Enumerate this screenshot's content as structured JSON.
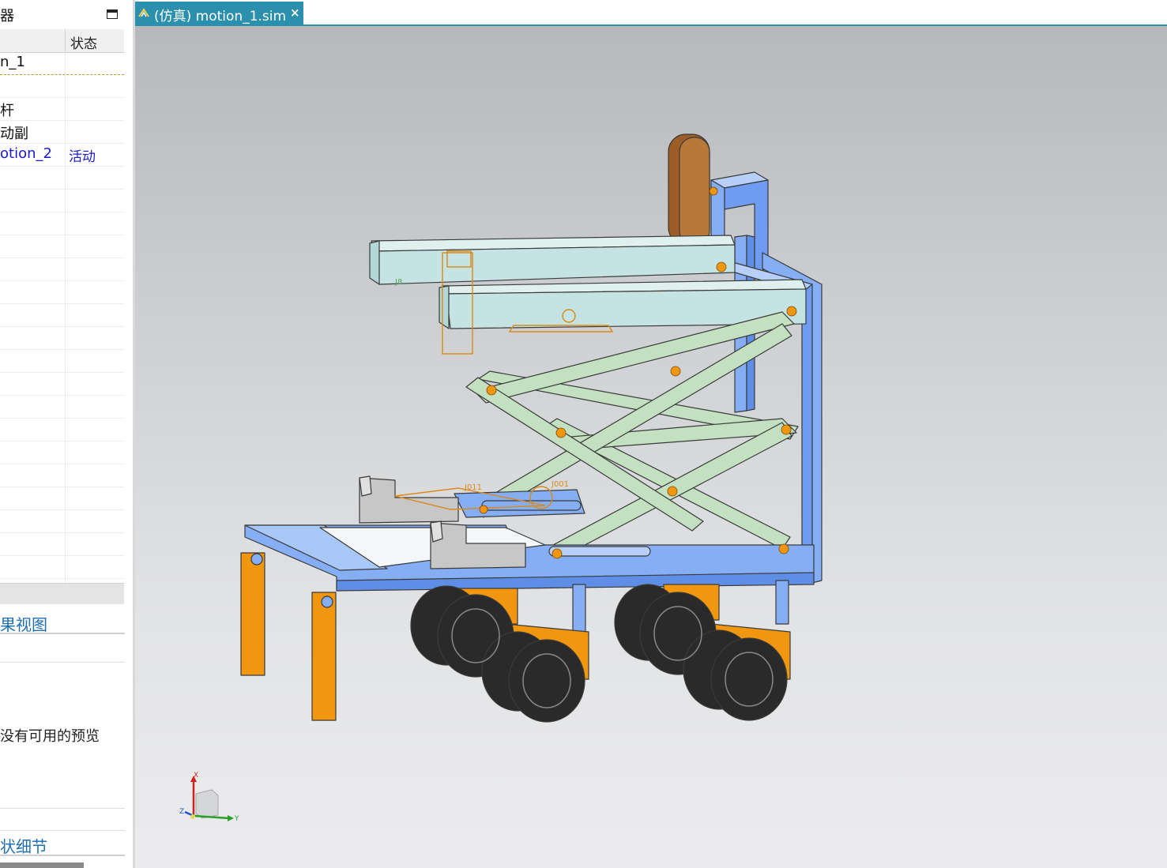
{
  "navigator": {
    "title": "器",
    "column_status": "状态",
    "rows": [
      {
        "name": "n_1",
        "status": ""
      },
      {
        "name": "",
        "status": ""
      },
      {
        "name": "杆",
        "status": ""
      },
      {
        "name": "动副",
        "status": ""
      },
      {
        "name": "otion_2",
        "status": "活动"
      },
      {
        "name": "",
        "status": ""
      },
      {
        "name": "",
        "status": ""
      },
      {
        "name": "",
        "status": ""
      },
      {
        "name": "",
        "status": ""
      },
      {
        "name": "",
        "status": ""
      },
      {
        "name": "",
        "status": ""
      },
      {
        "name": "",
        "status": ""
      },
      {
        "name": "",
        "status": ""
      },
      {
        "name": "",
        "status": ""
      },
      {
        "name": "",
        "status": ""
      },
      {
        "name": "",
        "status": ""
      },
      {
        "name": "",
        "status": ""
      },
      {
        "name": "",
        "status": ""
      },
      {
        "name": "",
        "status": ""
      },
      {
        "name": "",
        "status": ""
      },
      {
        "name": "",
        "status": ""
      },
      {
        "name": "",
        "status": ""
      },
      {
        "name": "",
        "status": ""
      },
      {
        "name": "",
        "status": ""
      }
    ]
  },
  "preview_section": {
    "title": "果视图",
    "empty_text": "没有可用的预览"
  },
  "details_section": {
    "title": "状细节"
  },
  "tab": {
    "label": "(仿真) motion_1.sim",
    "close": "×"
  },
  "model_labels": {
    "j8": "J8",
    "j011": "J011",
    "j001": "J001"
  },
  "triad": {
    "x": "X",
    "y": "Y",
    "z": "Z"
  },
  "colors": {
    "frame_blue": "#86aef5",
    "platform_teal": "#c6e3e3",
    "scissor_green": "#c3e0c0",
    "wheel_orange": "#f0960f",
    "headrest_brown": "#9c5e26",
    "tab_teal": "#2b8fae"
  }
}
